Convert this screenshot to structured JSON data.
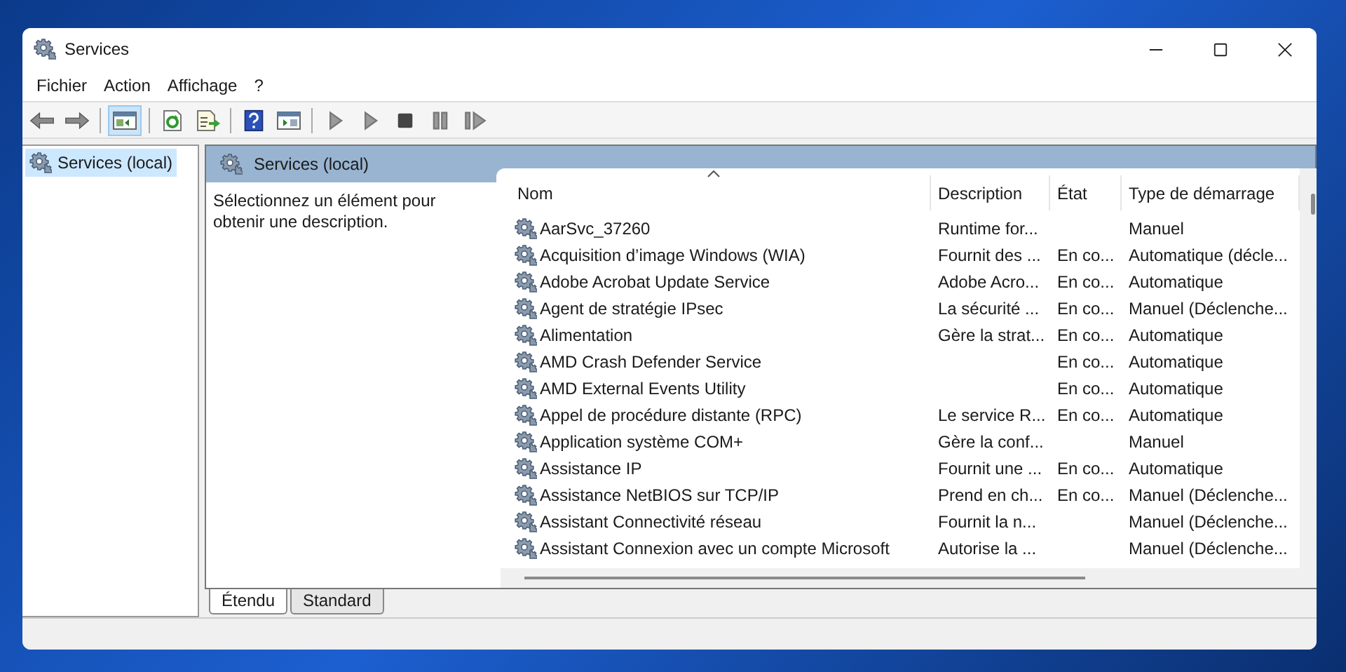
{
  "window": {
    "title": "Services"
  },
  "menu": [
    "Fichier",
    "Action",
    "Affichage",
    "?"
  ],
  "toolbar": [
    {
      "kind": "back"
    },
    {
      "kind": "forward"
    },
    {
      "kind": "sep"
    },
    {
      "kind": "tree",
      "selected": true
    },
    {
      "kind": "sep"
    },
    {
      "kind": "refresh"
    },
    {
      "kind": "export"
    },
    {
      "kind": "sep"
    },
    {
      "kind": "help"
    },
    {
      "kind": "console"
    },
    {
      "kind": "sep"
    },
    {
      "kind": "start"
    },
    {
      "kind": "start"
    },
    {
      "kind": "stop"
    },
    {
      "kind": "pause"
    },
    {
      "kind": "resume"
    }
  ],
  "tree": [
    {
      "label": "Services (local)",
      "selected": true
    }
  ],
  "panel": {
    "title": "Services (local)",
    "description": "Sélectionnez un élément pour obtenir une description."
  },
  "table": {
    "columns": [
      "Nom",
      "Description",
      "État",
      "Type de démarrage"
    ],
    "rows": [
      [
        "AarSvc_37260",
        "Runtime for...",
        "",
        "Manuel"
      ],
      [
        "Acquisition d’image Windows (WIA)",
        "Fournit des ...",
        "En co...",
        "Automatique (décle..."
      ],
      [
        "Adobe Acrobat Update Service",
        "Adobe Acro...",
        "En co...",
        "Automatique"
      ],
      [
        "Agent de stratégie IPsec",
        "La sécurité ...",
        "En co...",
        "Manuel (Déclenche..."
      ],
      [
        "Alimentation",
        "Gère la strat...",
        "En co...",
        "Automatique"
      ],
      [
        "AMD Crash Defender Service",
        "",
        "En co...",
        "Automatique"
      ],
      [
        "AMD External Events Utility",
        "",
        "En co...",
        "Automatique"
      ],
      [
        "Appel de procédure distante (RPC)",
        "Le service R...",
        "En co...",
        "Automatique"
      ],
      [
        "Application système COM+",
        "Gère la conf...",
        "",
        "Manuel"
      ],
      [
        "Assistance IP",
        "Fournit une ...",
        "En co...",
        "Automatique"
      ],
      [
        "Assistance NetBIOS sur TCP/IP",
        "Prend en ch...",
        "En co...",
        "Manuel (Déclenche..."
      ],
      [
        "Assistant Connectivité réseau",
        "Fournit la n...",
        "",
        "Manuel (Déclenche..."
      ],
      [
        "Assistant Connexion avec un compte Microsoft",
        "Autorise la ...",
        "",
        "Manuel (Déclenche..."
      ]
    ]
  },
  "tabs": [
    {
      "label": "Étendu",
      "selected": true
    },
    {
      "label": "Standard",
      "selected": false
    }
  ]
}
